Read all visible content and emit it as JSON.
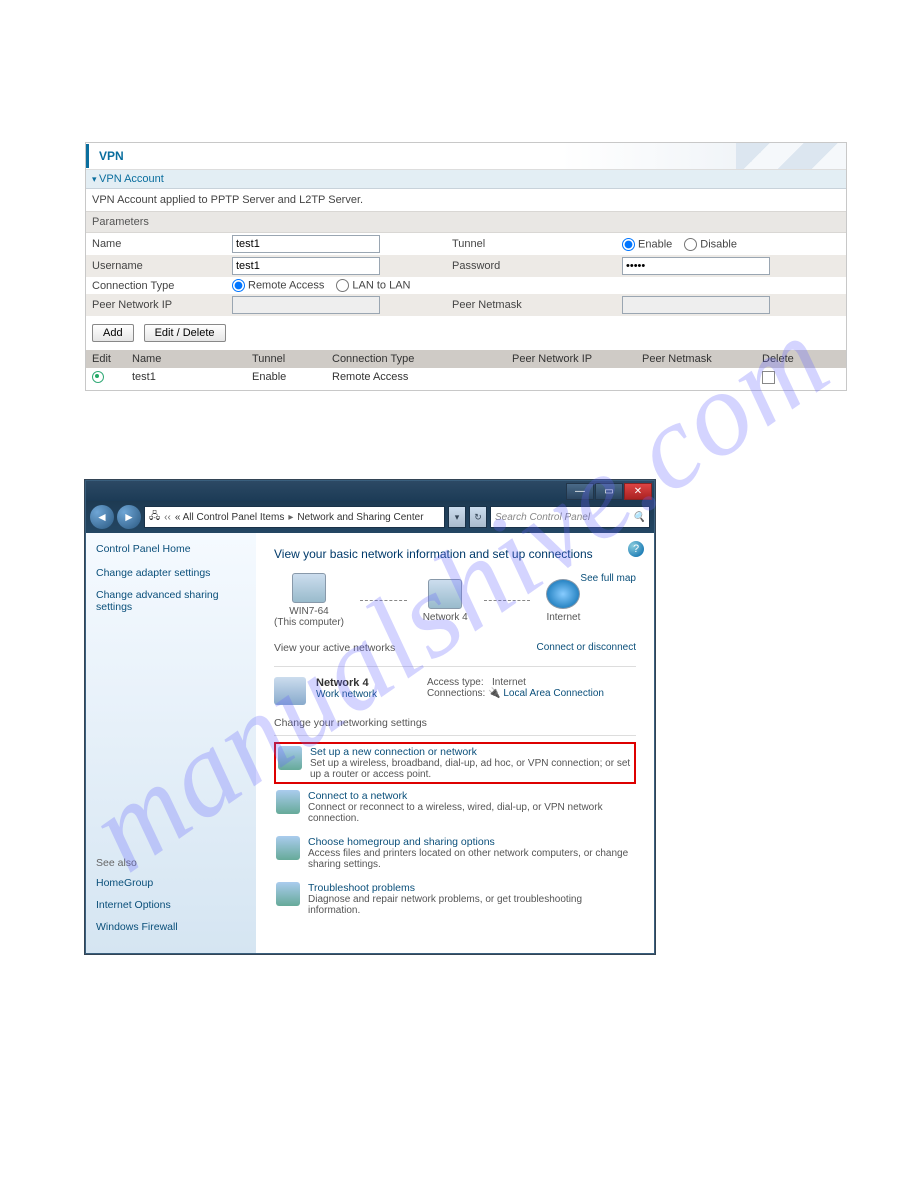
{
  "watermark": "manualshive.com",
  "vpn": {
    "title": "VPN",
    "section": "VPN Account",
    "desc": "VPN Account applied to PPTP Server and L2TP Server.",
    "params_label": "Parameters",
    "name_label": "Name",
    "name_value": "test1",
    "tunnel_label": "Tunnel",
    "enable_label": "Enable",
    "disable_label": "Disable",
    "username_label": "Username",
    "username_value": "test1",
    "password_label": "Password",
    "password_value": "•••••",
    "conntype_label": "Connection Type",
    "remote_label": "Remote Access",
    "lan_label": "LAN to LAN",
    "peerip_label": "Peer Network IP",
    "peermask_label": "Peer Netmask",
    "add_btn": "Add",
    "edit_btn": "Edit / Delete",
    "cols": {
      "edit": "Edit",
      "name": "Name",
      "tunnel": "Tunnel",
      "conn": "Connection Type",
      "peerip": "Peer Network IP",
      "peermask": "Peer Netmask",
      "del": "Delete"
    },
    "row": {
      "name": "test1",
      "tunnel": "Enable",
      "conn": "Remote Access",
      "peerip": "",
      "peermask": ""
    }
  },
  "win": {
    "breadcrumb_prefix": "« All Control Panel Items",
    "breadcrumb_current": "Network and Sharing Center",
    "search_placeholder": "Search Control Panel",
    "sidebar": {
      "home": "Control Panel Home",
      "adapter": "Change adapter settings",
      "advanced": "Change advanced sharing settings",
      "seealso": "See also",
      "homegroup": "HomeGroup",
      "inet": "Internet Options",
      "fw": "Windows Firewall"
    },
    "heading": "View your basic network information and set up connections",
    "fullmap": "See full map",
    "nodes": {
      "pc": "WIN7-64",
      "pc_sub": "(This computer)",
      "net": "Network 4",
      "inet": "Internet"
    },
    "active_label": "View your active networks",
    "connect_disconnect": "Connect or disconnect",
    "active": {
      "name": "Network 4",
      "type": "Work network",
      "access_lbl": "Access type:",
      "access": "Internet",
      "conn_lbl": "Connections:",
      "conn": "Local Area Connection"
    },
    "change_label": "Change your networking settings",
    "options": [
      {
        "title": "Set up a new connection or network",
        "desc": "Set up a wireless, broadband, dial-up, ad hoc, or VPN connection; or set up a router or access point.",
        "highlight": true
      },
      {
        "title": "Connect to a network",
        "desc": "Connect or reconnect to a wireless, wired, dial-up, or VPN network connection.",
        "highlight": false
      },
      {
        "title": "Choose homegroup and sharing options",
        "desc": "Access files and printers located on other network computers, or change sharing settings.",
        "highlight": false
      },
      {
        "title": "Troubleshoot problems",
        "desc": "Diagnose and repair network problems, or get troubleshooting information.",
        "highlight": false
      }
    ]
  }
}
